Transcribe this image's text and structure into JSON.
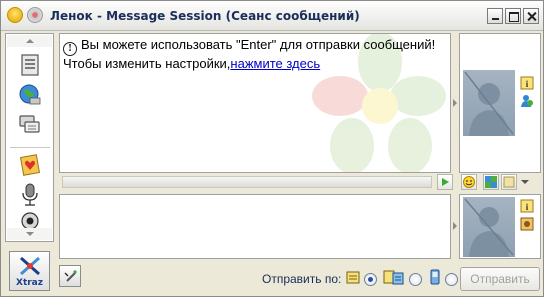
{
  "window": {
    "title": "Ленок - Message Session (Сеанс сообщений)"
  },
  "history": {
    "info_line": "Вы можете использовать \"Enter\" для отправки сообщений!",
    "settings_prefix": "Чтобы изменить настройки,",
    "settings_link": "нажмите здесь"
  },
  "sidebar": {
    "items": [
      {
        "icon": "notes-icon"
      },
      {
        "icon": "globe-icon"
      },
      {
        "icon": "chat-icon"
      },
      {
        "icon": "greeting-card-icon"
      },
      {
        "icon": "microphone-icon"
      },
      {
        "icon": "webcam-icon"
      }
    ]
  },
  "toolbar": {
    "buttons": [
      {
        "icon": "play-icon"
      },
      {
        "icon": "smiley-icon"
      },
      {
        "icon": "puzzle-icon"
      },
      {
        "icon": "format-icon"
      }
    ]
  },
  "bottom": {
    "xtraz_label": "Xtraz",
    "send_via_label": "Отправить по:",
    "send_button": "Отправить",
    "modes": [
      {
        "icon": "pager-icon",
        "selected": true
      },
      {
        "icon": "multi-pager-icon",
        "selected": false
      },
      {
        "icon": "mobile-icon",
        "selected": false
      }
    ]
  },
  "colors": {
    "title_text": "#1b2e5a",
    "link": "#0000c8",
    "accent": "#2b4fa8"
  }
}
